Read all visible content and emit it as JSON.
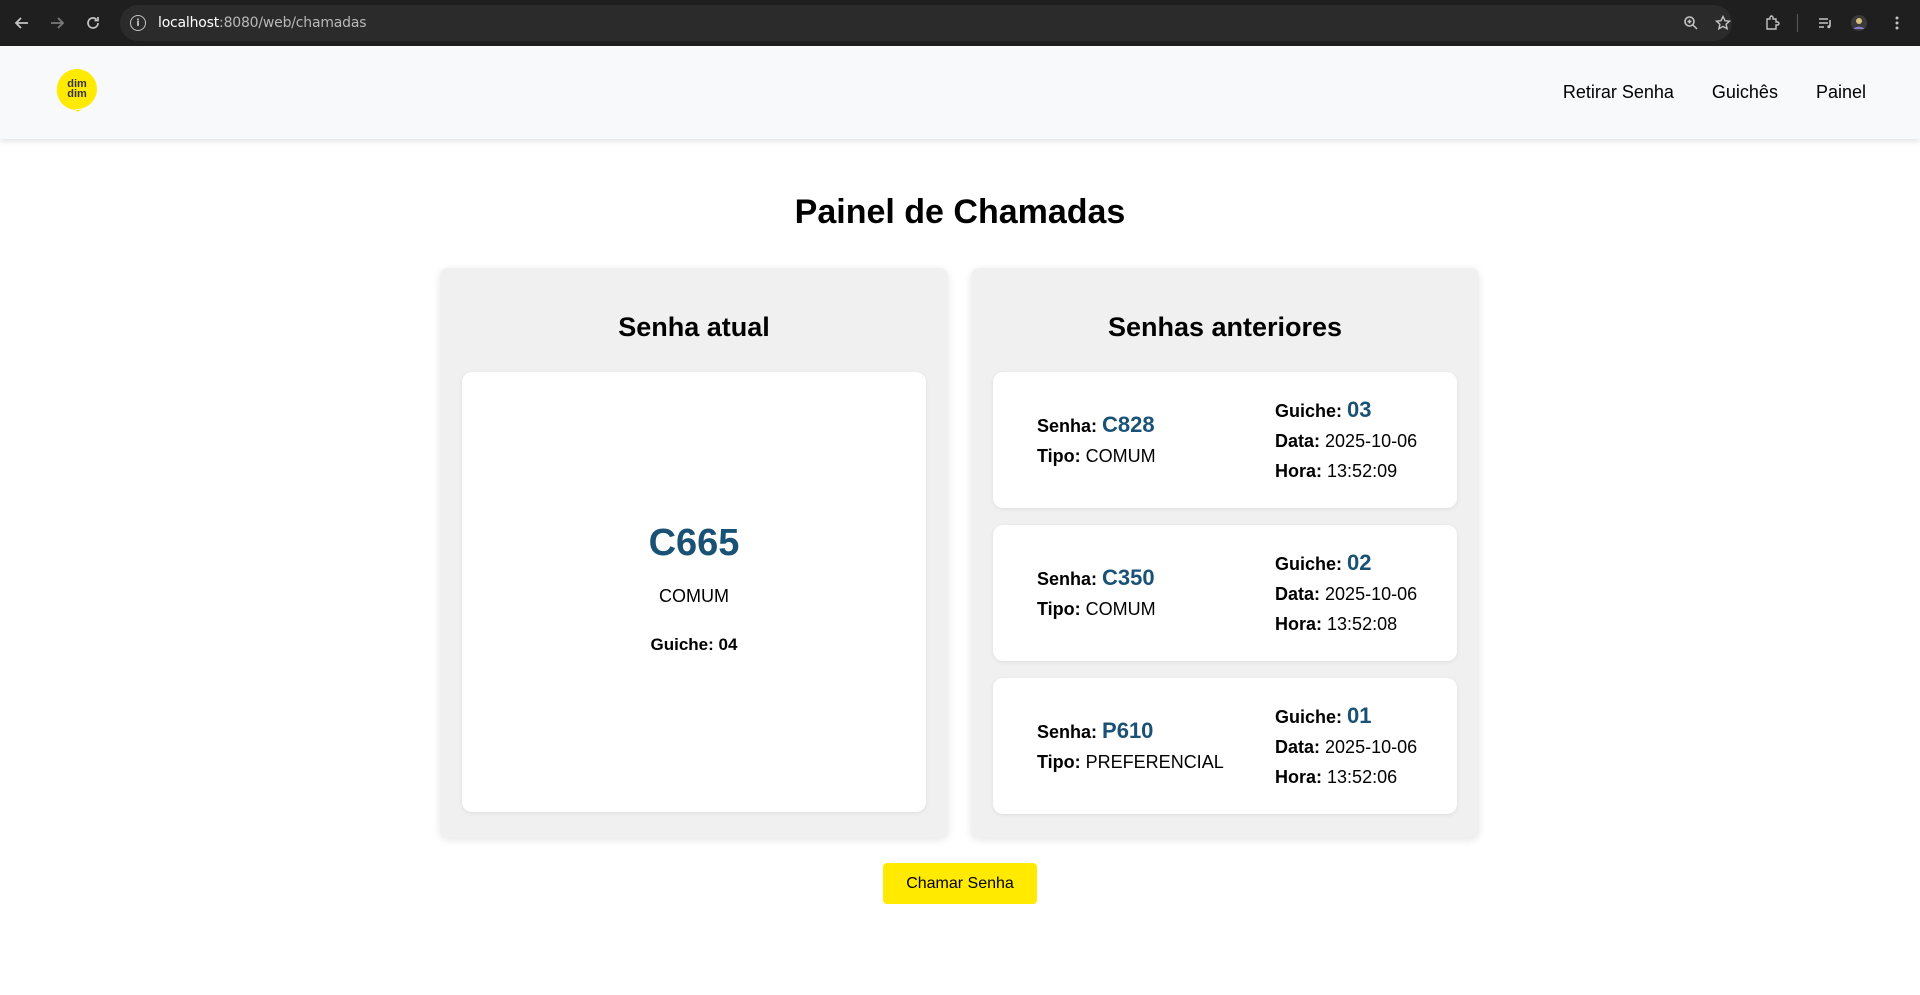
{
  "browser": {
    "url_host": "localhost",
    "url_rest": ":8080/web/chamadas"
  },
  "navbar": {
    "logo_text_1": "dim",
    "logo_text_2": "dim",
    "links": [
      "Retirar Senha",
      "Guichês",
      "Painel"
    ]
  },
  "main": {
    "title": "Painel de Chamadas",
    "current": {
      "heading": "Senha atual",
      "code": "C665",
      "type": "COMUM",
      "guiche_label": "Guiche:",
      "guiche_value": "04"
    },
    "previous": {
      "heading": "Senhas anteriores",
      "labels": {
        "senha": "Senha:",
        "tipo": "Tipo:",
        "guiche": "Guiche:",
        "data": "Data:",
        "hora": "Hora:"
      },
      "items": [
        {
          "senha": "C828",
          "tipo": "COMUM",
          "guiche": "03",
          "data": "2025-10-06",
          "hora": "13:52:09"
        },
        {
          "senha": "C350",
          "tipo": "COMUM",
          "guiche": "02",
          "data": "2025-10-06",
          "hora": "13:52:08"
        },
        {
          "senha": "P610",
          "tipo": "PREFERENCIAL",
          "guiche": "01",
          "data": "2025-10-06",
          "hora": "13:52:06"
        }
      ]
    },
    "call_button": "Chamar Senha"
  },
  "colors": {
    "accent_yellow": "#ffea00",
    "code_blue": "#1a5276",
    "panel_bg": "#f0f0f0",
    "navbar_bg": "#f8f9fa"
  }
}
